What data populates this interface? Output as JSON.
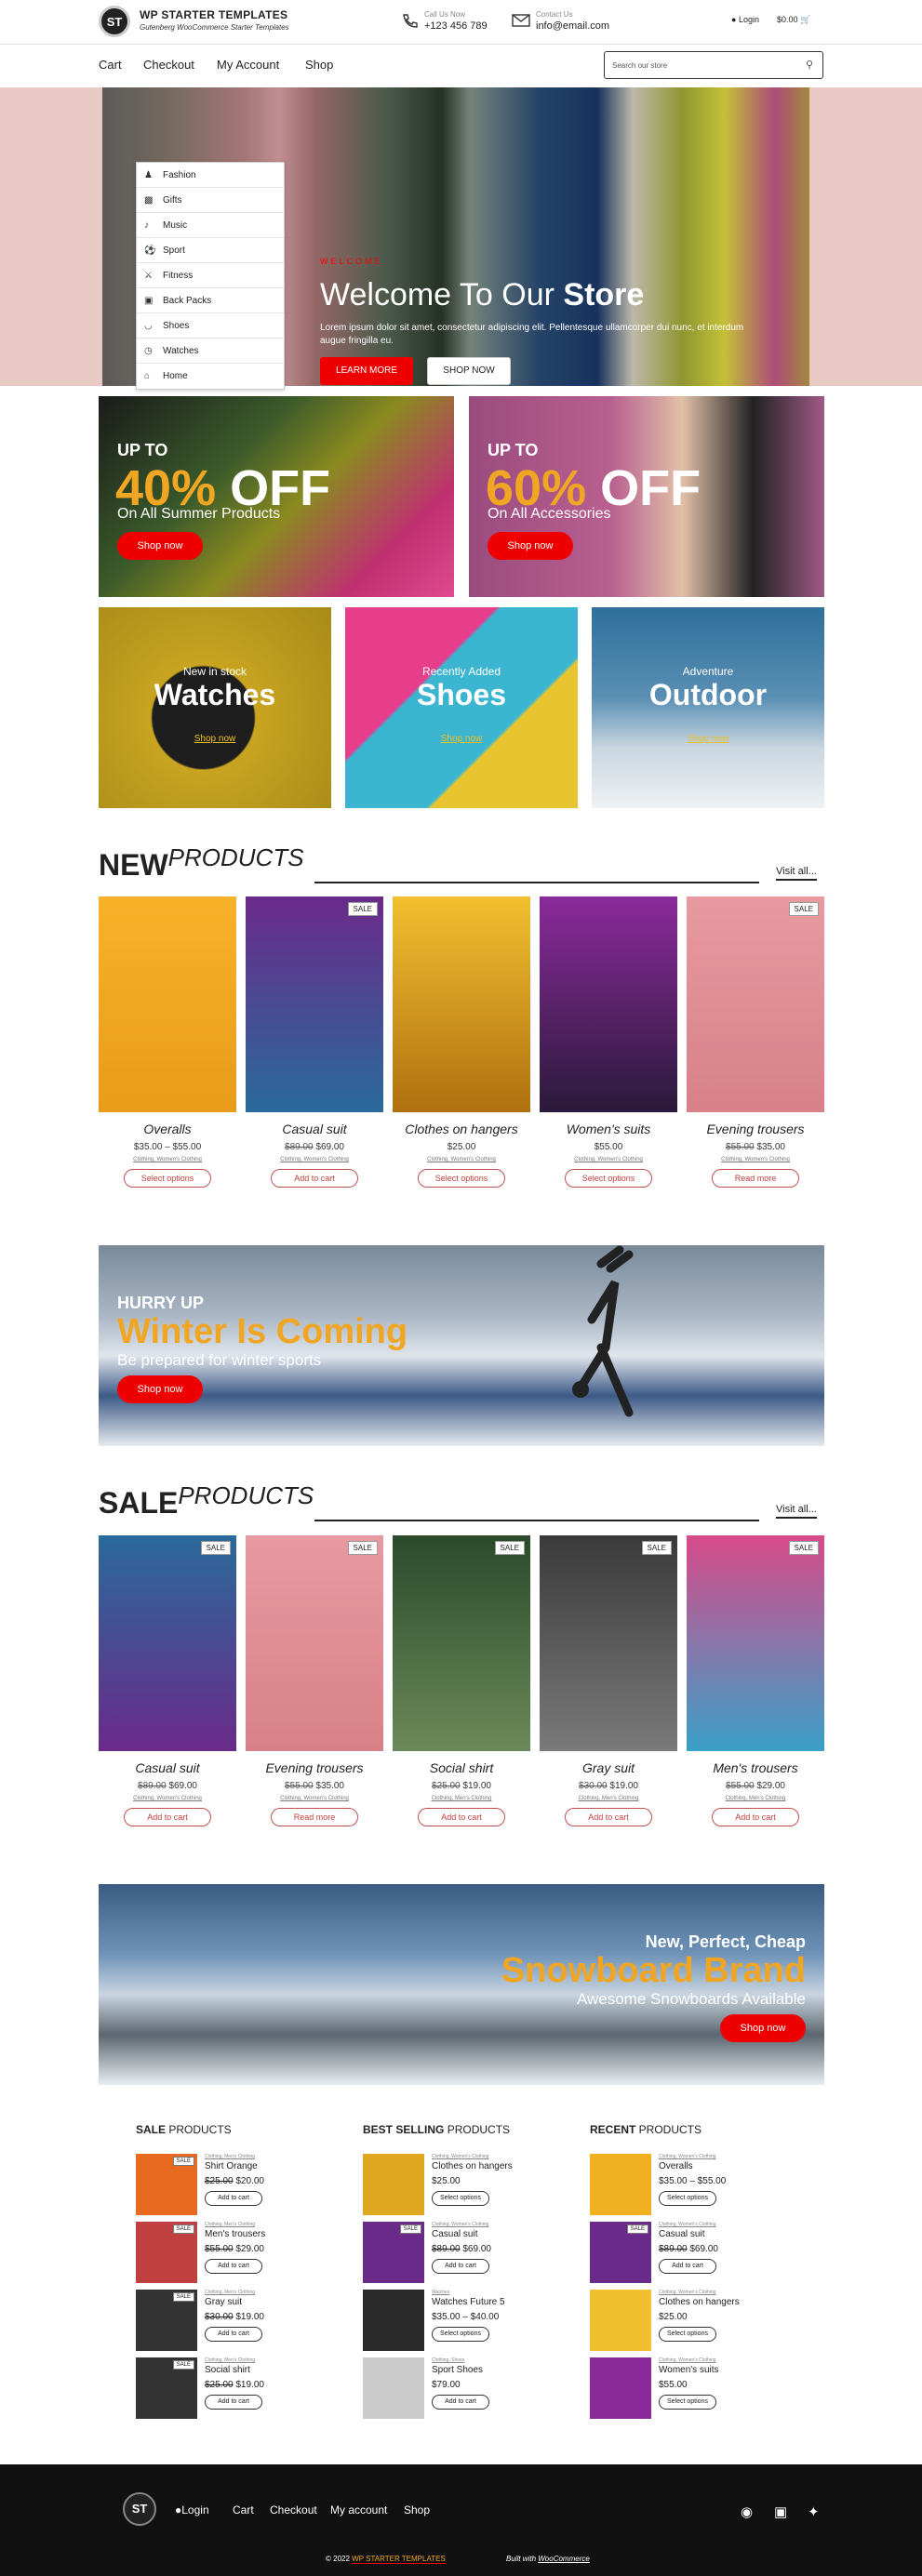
{
  "header": {
    "brand": "WP STARTER TEMPLATES",
    "tagline": "Gutenberg WooCommerce Starter Templates",
    "logo_text": "ST",
    "phone_label": "Call Us Now",
    "phone": "+123 456 789",
    "email_label": "Contact Us",
    "email": "info@email.com",
    "login": "Login",
    "cart_total": "$0.00"
  },
  "nav": {
    "items": [
      "Cart",
      "Checkout",
      "My Account",
      "Shop"
    ],
    "search_placeholder": "Search our store"
  },
  "categories_menu": [
    "Fashion",
    "Gifts",
    "Music",
    "Sport",
    "Fitness",
    "Back Packs",
    "Shoes",
    "Watches",
    "Home"
  ],
  "hero": {
    "welcome": "WELCOME",
    "title_a": "Welcome To Our ",
    "title_b": "Store",
    "text": "Lorem ipsum dolor sit amet, consectetur adipiscing elit. Pellentesque ullamcorper dui nunc, et interdum augue fringilla eu.",
    "btn1": "LEARN MORE",
    "btn2": "SHOP NOW"
  },
  "promos": [
    {
      "up": "UP TO",
      "pct": "40%",
      "off": " OFF",
      "sub": "On All Summer Products",
      "btn": "Shop now"
    },
    {
      "up": "UP TO",
      "pct": "60%",
      "off": " OFF",
      "sub": "On All Accessories",
      "btn": "Shop now"
    }
  ],
  "cats": [
    {
      "small": "New in stock",
      "big": "Watches",
      "shop": "Shop now"
    },
    {
      "small": "Recently Added",
      "big": "Shoes",
      "shop": "Shop now"
    },
    {
      "small": "Adventure",
      "big": "Outdoor",
      "shop": "Shop now"
    }
  ],
  "new_products": {
    "title_a": "NEW",
    "title_b": "PRODUCTS",
    "visit": "Visit all...",
    "items": [
      {
        "name": "Overalls",
        "old": "",
        "price": "$35.00 – $55.00",
        "cat": "Clothing, Women's Clothing",
        "btn": "Select options",
        "sale": ""
      },
      {
        "name": "Casual suit",
        "old": "$89.00",
        "price": "$69.00",
        "cat": "Clothing, Women's Clothing",
        "btn": "Add to cart",
        "sale": "SALE"
      },
      {
        "name": "Clothes on hangers",
        "old": "",
        "price": "$25.00",
        "cat": "Clothing, Women's Clothing",
        "btn": "Select options",
        "sale": ""
      },
      {
        "name": "Women's suits",
        "old": "",
        "price": "$55.00",
        "cat": "Clothing, Women's Clothing",
        "btn": "Select options",
        "sale": ""
      },
      {
        "name": "Evening trousers",
        "old": "$55.00",
        "price": "$35.00",
        "cat": "Clothing, Women's Clothing",
        "btn": "Read more",
        "sale": "SALE"
      }
    ]
  },
  "winter": {
    "hurry": "HURRY UP",
    "title": "Winter Is Coming",
    "sub": "Be prepared for winter sports",
    "btn": "Shop now"
  },
  "sale_products": {
    "title_a": "SALE",
    "title_b": "PRODUCTS",
    "visit": "Visit all...",
    "items": [
      {
        "name": "Casual suit",
        "old": "$89.00",
        "price": "$69.00",
        "cat": "Clothing, Women's Clothing",
        "btn": "Add to cart",
        "sale": "SALE"
      },
      {
        "name": "Evening trousers",
        "old": "$55.00",
        "price": "$35.00",
        "cat": "Clothing, Women's Clothing",
        "btn": "Read more",
        "sale": "SALE"
      },
      {
        "name": "Social shirt",
        "old": "$25.00",
        "price": "$19.00",
        "cat": "Clothing, Men's Clothing",
        "btn": "Add to cart",
        "sale": "SALE"
      },
      {
        "name": "Gray suit",
        "old": "$30.00",
        "price": "$19.00",
        "cat": "Clothing, Men's Clothing",
        "btn": "Add to cart",
        "sale": "SALE"
      },
      {
        "name": "Men's trousers",
        "old": "$55.00",
        "price": "$29.00",
        "cat": "Clothing, Men's Clothing",
        "btn": "Add to cart",
        "sale": "SALE"
      }
    ]
  },
  "snowboard": {
    "line1": "New, Perfect, Cheap",
    "title": "Snowboard Brand",
    "sub": "Awesome Snowboards Available",
    "btn": "Shop now"
  },
  "widgets": [
    {
      "title_a": "SALE ",
      "title_b": "PRODUCTS",
      "items": [
        {
          "cat": "Clothing, Men's Clothing",
          "name": "Shirt Orange",
          "old": "$25.00",
          "price": "$20.00",
          "btn": "Add to cart",
          "sale": "SALE"
        },
        {
          "cat": "Clothing, Men's Clothing",
          "name": "Men's trousers",
          "old": "$55.00",
          "price": "$29.00",
          "btn": "Add to cart",
          "sale": "SALE"
        },
        {
          "cat": "Clothing, Men's Clothing",
          "name": "Gray suit",
          "old": "$30.00",
          "price": "$19.00",
          "btn": "Add to cart",
          "sale": "SALE"
        },
        {
          "cat": "Clothing, Men's Clothing",
          "name": "Social shirt",
          "old": "$25.00",
          "price": "$19.00",
          "btn": "Add to cart",
          "sale": "SALE"
        }
      ]
    },
    {
      "title_a": "BEST SELLING ",
      "title_b": "PRODUCTS",
      "items": [
        {
          "cat": "Clothing, Women's Clothing",
          "name": "Clothes on hangers",
          "old": "",
          "price": "$25.00",
          "btn": "Select options",
          "sale": ""
        },
        {
          "cat": "Clothing, Women's Clothing",
          "name": "Casual suit",
          "old": "$89.00",
          "price": "$69.00",
          "btn": "Add to cart",
          "sale": "SALE"
        },
        {
          "cat": "Watches",
          "name": "Watches Future 5",
          "old": "",
          "price": "$35.00 – $40.00",
          "btn": "Select options",
          "sale": ""
        },
        {
          "cat": "Clothing, Shoes",
          "name": "Sport Shoes",
          "old": "",
          "price": "$79.00",
          "btn": "Add to cart",
          "sale": ""
        }
      ]
    },
    {
      "title_a": "RECENT ",
      "title_b": "PRODUCTS",
      "items": [
        {
          "cat": "Clothing, Women's Clothing",
          "name": "Overalls",
          "old": "",
          "price": "$35.00 – $55.00",
          "btn": "Select options",
          "sale": ""
        },
        {
          "cat": "Clothing, Women's Clothing",
          "name": "Casual suit",
          "old": "$89.00",
          "price": "$69.00",
          "btn": "Add to cart",
          "sale": "SALE"
        },
        {
          "cat": "Clothing, Women's Clothing",
          "name": "Clothes on hangers",
          "old": "",
          "price": "$25.00",
          "btn": "Select options",
          "sale": ""
        },
        {
          "cat": "Clothing, Women's Clothing",
          "name": "Women's suits",
          "old": "",
          "price": "$55.00",
          "btn": "Select options",
          "sale": ""
        }
      ]
    }
  ],
  "footer": {
    "logo_text": "ST",
    "links": [
      "Login",
      "Cart",
      "Checkout",
      "My account",
      "Shop"
    ],
    "copy_year": "© 2022",
    "copy_brand": "WP STARTER TEMPLATES",
    "built": "Built with",
    "built_link": "WooCommerce"
  },
  "colors": {
    "accent": "#e00000",
    "gold": "#f0a623",
    "dark": "#111111"
  }
}
